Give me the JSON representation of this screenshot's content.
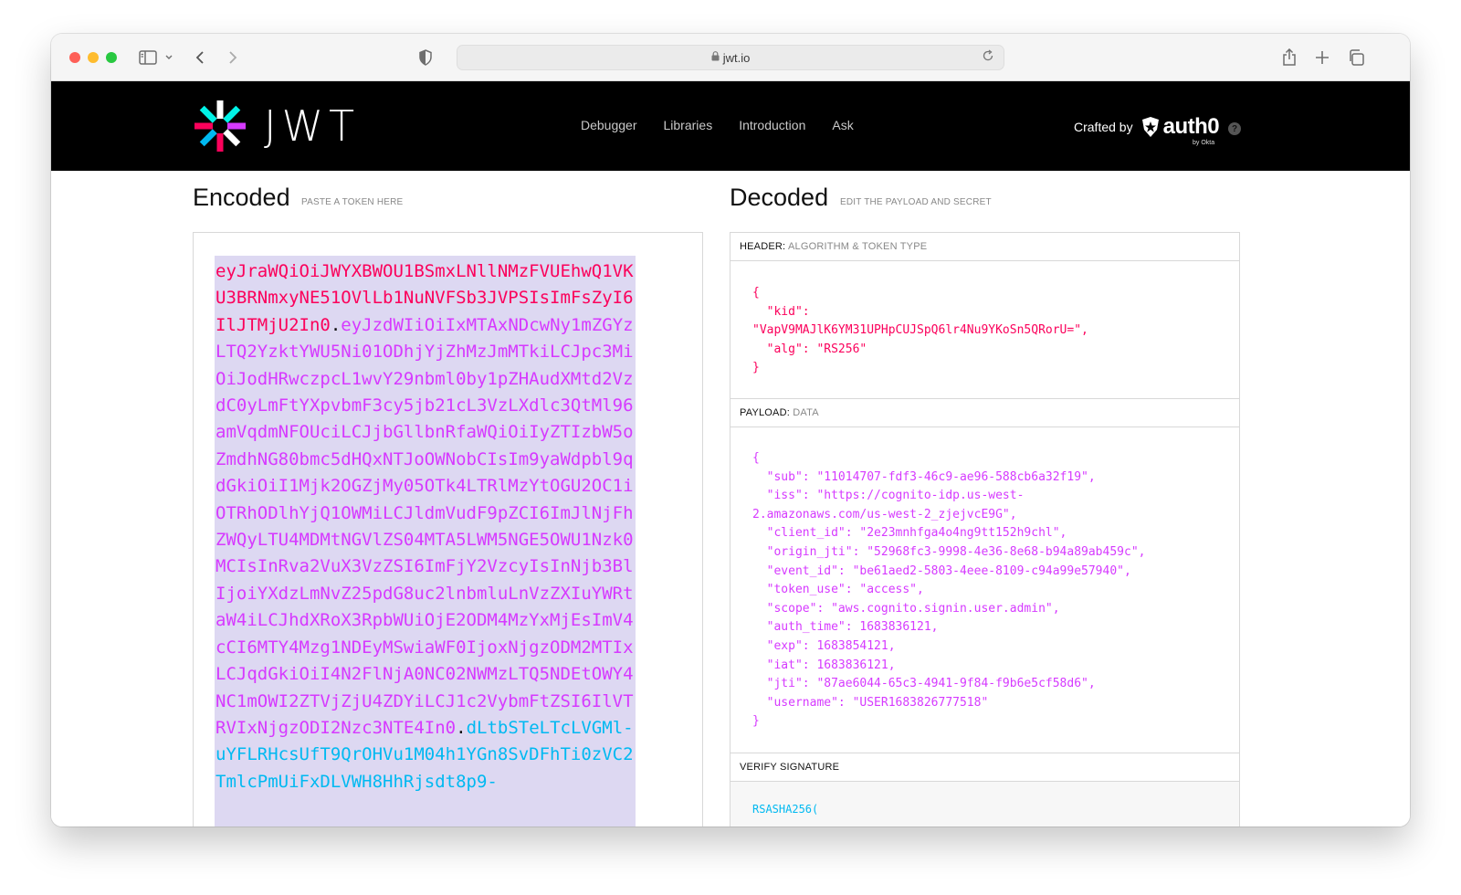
{
  "browser": {
    "url": "jwt.io"
  },
  "site": {
    "logo_text": "JWT",
    "nav": [
      "Debugger",
      "Libraries",
      "Introduction",
      "Ask"
    ],
    "crafted_by": "Crafted by",
    "auth0_label": "auth0",
    "by_okta": "by Okta",
    "help": "?"
  },
  "encoded": {
    "title": "Encoded",
    "subtitle": "PASTE A TOKEN HERE",
    "token_header": "eyJraWQiOiJWYXBWOU1BSmxLNllNMzFVUEhwQ1VKU3BRNmxyNE51OVlLb1NuNVFSb3JVPSIsImFsZyI6IlJTMjU2In0",
    "dot": ".",
    "token_payload": "eyJzdWIiOiIxMTAxNDcwNy1mZGYzLTQ2YzktYWU5Ni01ODhjYjZhMzJmMTkiLCJpc3MiOiJodHRwczpcL1wvY29nbml0by1pZHAudXMtd2VzdC0yLmFtYXpvbmF3cy5jb21cL3VzLXdlc3QtMl96amVqdmNFOUciLCJjbGllbnRfaWQiOiIyZTIzbW5oZmdhNG80bmc5dHQxNTJoOWNobCIsIm9yaWdpbl9qdGkiOiI1Mjk2OGZjMy05OTk4LTRlMzYtOGU2OC1iOTRhODlhYjQ1OWMiLCJldmVudF9pZCI6ImJlNjFhZWQyLTU4MDMtNGVlZS04MTA5LWM5NGE5OWU1Nzk0MCIsInRva2VuX3VzZSI6ImFjY2VzcyIsInNjb3BlIjoiYXdzLmNvZ25pdG8uc2lnbmluLnVzZXIuYWRtaW4iLCJhdXRoX3RpbWUiOjE2ODM4MzYxMjEsImV4cCI6MTY4Mzg1NDEyMSwiaWF0IjoxNjgzODM2MTIxLCJqdGkiOiI4N2FlNjA0NC02NWMzLTQ5NDEtOWY4NC1mOWI2ZTVjZjU4ZDYiLCJ1c2VybmFtZSI6IlVTRVIxNjgzODI2Nzc3NTE4In0",
    "token_signature": "dLtbSTeLTcLVGMl-uYFLRHcsUfT9QrOHVu1M04h1YGn8SvDFhTi0zVC2TmlcPmUiFxDLVWH8HhRjsdt8p9-"
  },
  "decoded": {
    "title": "Decoded",
    "subtitle": "EDIT THE PAYLOAD AND SECRET",
    "header_label": "HEADER:",
    "header_sub": "ALGORITHM & TOKEN TYPE",
    "header_json": "{\n  \"kid\":\n\"VapV9MAJlK6YM31UPHpCUJSpQ6lr4Nu9YKoSn5QRorU=\",\n  \"alg\": \"RS256\"\n}",
    "payload_label": "PAYLOAD:",
    "payload_sub": "DATA",
    "payload_json": "{\n  \"sub\": \"11014707-fdf3-46c9-ae96-588cb6a32f19\",\n  \"iss\": \"https://cognito-idp.us-west-\n2.amazonaws.com/us-west-2_zjejvcE9G\",\n  \"client_id\": \"2e23mnhfga4o4ng9tt152h9chl\",\n  \"origin_jti\": \"52968fc3-9998-4e36-8e68-b94a89ab459c\",\n  \"event_id\": \"be61aed2-5803-4eee-8109-c94a99e57940\",\n  \"token_use\": \"access\",\n  \"scope\": \"aws.cognito.signin.user.admin\",\n  \"auth_time\": 1683836121,\n  \"exp\": 1683854121,\n  \"iat\": 1683836121,\n  \"jti\": \"87ae6044-65c3-4941-9f84-f9b6e5cf58d6\",\n  \"username\": \"USER1683826777518\"\n}",
    "signature_label": "VERIFY SIGNATURE",
    "signature_first_line": "RSASHA256("
  }
}
